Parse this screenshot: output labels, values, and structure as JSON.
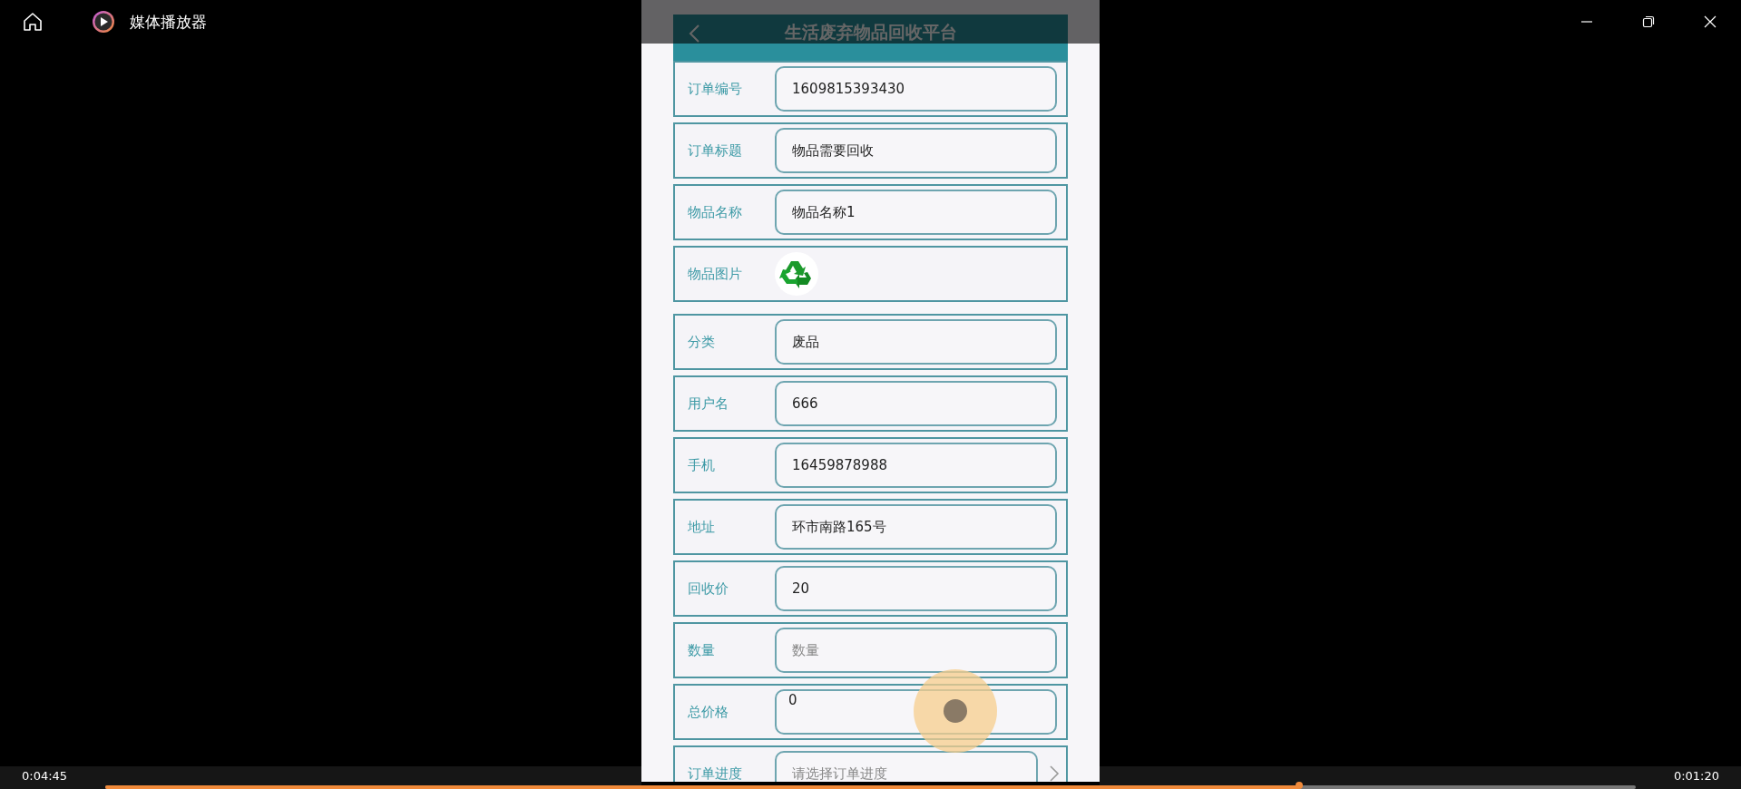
{
  "window": {
    "title": "媒体播放器"
  },
  "app": {
    "header_title": "生活废弃物品回收平台",
    "rows": [
      {
        "kind": "input",
        "label": "订单编号",
        "value": "1609815393430"
      },
      {
        "kind": "input",
        "label": "订单标题",
        "value": "物品需要回收"
      },
      {
        "kind": "input",
        "label": "物品名称",
        "value": "物品名称1"
      },
      {
        "kind": "image",
        "label": "物品图片"
      },
      {
        "kind": "input",
        "label": "分类",
        "value": "废品"
      },
      {
        "kind": "input",
        "label": "用户名",
        "value": "666"
      },
      {
        "kind": "input",
        "label": "手机",
        "value": "16459878988"
      },
      {
        "kind": "input",
        "label": "地址",
        "value": "环市南路165号"
      },
      {
        "kind": "input",
        "label": "回收价",
        "value": "20"
      },
      {
        "kind": "input",
        "label": "数量",
        "placeholder": "数量"
      },
      {
        "kind": "textarea",
        "label": "总价格",
        "value": "0"
      },
      {
        "kind": "select",
        "label": "订单进度",
        "placeholder": "请选择订单进度"
      }
    ]
  },
  "player": {
    "elapsed": "0:04:45",
    "remaining": "0:01:20",
    "progress": {
      "level": 0.78
    }
  }
}
